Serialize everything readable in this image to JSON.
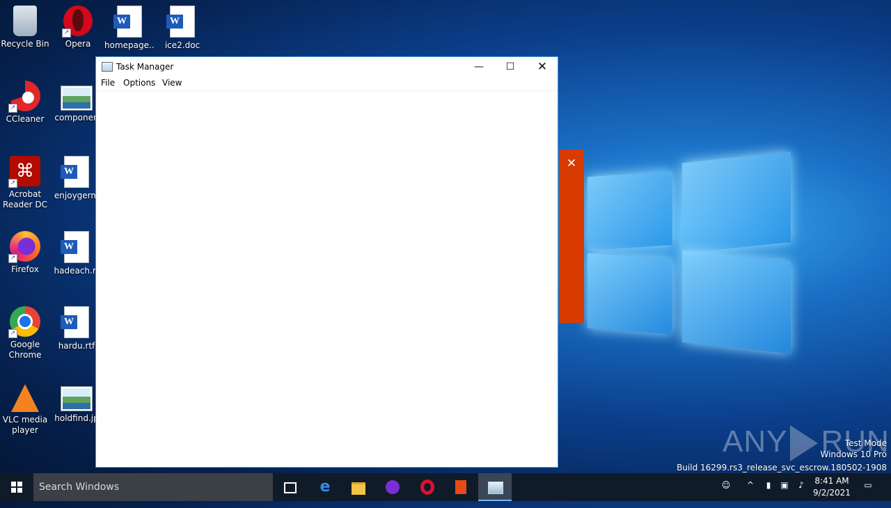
{
  "desktop": {
    "icons": [
      {
        "label": "Recycle Bin"
      },
      {
        "label": "Opera"
      },
      {
        "label": "homepage..."
      },
      {
        "label": "ice2.doc"
      },
      {
        "label": "CCleaner"
      },
      {
        "label": "componen"
      },
      {
        "label": "Acrobat Reader DC"
      },
      {
        "label": "enjoygerm"
      },
      {
        "label": "Firefox"
      },
      {
        "label": "hadeach.rt"
      },
      {
        "label": "Google Chrome"
      },
      {
        "label": "hardu.rtf"
      },
      {
        "label": "VLC media player"
      },
      {
        "label": "holdfind.jp"
      }
    ]
  },
  "window": {
    "title": "Task Manager",
    "minimize_glyph": "—",
    "maximize_glyph": "☐",
    "close_glyph": "✕",
    "menu": [
      "File",
      "Options",
      "View"
    ]
  },
  "side_panel": {
    "close_glyph": "✕",
    "color": "#d83b01"
  },
  "watermark": {
    "logo_left": "ANY",
    "logo_right": "RUN",
    "line1": "Test Mode",
    "line2": "Windows 10 Pro",
    "line3": "Build 16299.rs3_release_svc_escrow.180502-1908"
  },
  "taskbar": {
    "search_placeholder": "Search Windows",
    "time": "8:41 AM",
    "date": "9/2/2021"
  }
}
